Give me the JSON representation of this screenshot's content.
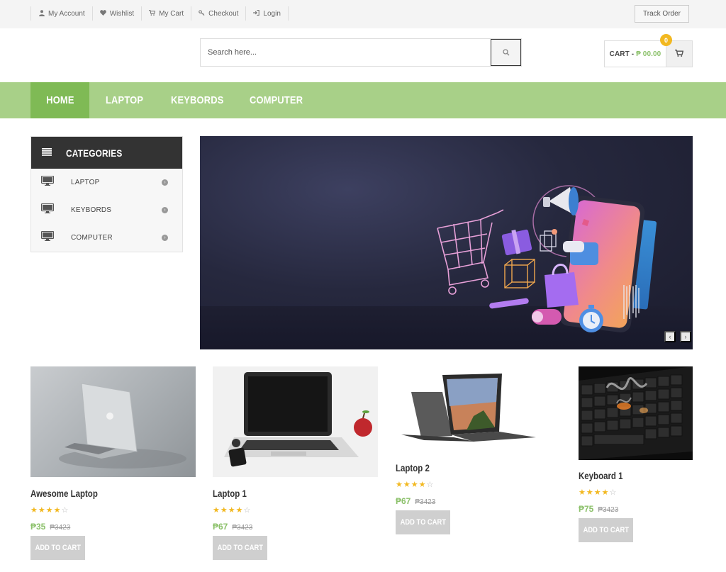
{
  "topbar": {
    "links": [
      {
        "label": "My Account",
        "icon": "user-icon"
      },
      {
        "label": "Wishlist",
        "icon": "heart-icon"
      },
      {
        "label": "My Cart",
        "icon": "cart-icon"
      },
      {
        "label": "Checkout",
        "icon": "key-icon"
      },
      {
        "label": "Login",
        "icon": "login-icon"
      }
    ],
    "track_order": "Track Order"
  },
  "header": {
    "search_placeholder": "Search here...",
    "cart_label": "CART -",
    "cart_amount": "₱ 00.00",
    "cart_count": "0"
  },
  "nav": {
    "items": [
      "HOME",
      "LAPTOP",
      "KEYBORDS",
      "COMPUTER"
    ],
    "active": "HOME"
  },
  "categories": {
    "title": "CATEGORIES",
    "items": [
      "LAPTOP",
      "KEYBORDS",
      "COMPUTER"
    ]
  },
  "banner": {
    "prev_icon": "chevron-left-icon",
    "next_icon": "chevron-right-icon"
  },
  "products": [
    {
      "title": "Awesome Laptop",
      "rating": 4,
      "max_rating": 5,
      "price": "₱35",
      "old_price": "₱3423",
      "button": "ADD TO CART"
    },
    {
      "title": "Laptop 1",
      "rating": 4,
      "max_rating": 5,
      "price": "₱67",
      "old_price": "₱3423",
      "button": "ADD TO CART"
    },
    {
      "title": "Laptop 2",
      "rating": 4,
      "max_rating": 5,
      "price": "₱67",
      "old_price": "₱3423",
      "button": "ADD TO CART"
    },
    {
      "title": "Keyboard 1",
      "rating": 4,
      "max_rating": 5,
      "price": "₱75",
      "old_price": "₱3423",
      "button": "ADD TO CART"
    }
  ],
  "colors": {
    "accent_green": "#7fba55",
    "nav_green": "#a8d088",
    "price_green": "#8cc16b",
    "star_yellow": "#f2b820",
    "dark": "#333333"
  }
}
